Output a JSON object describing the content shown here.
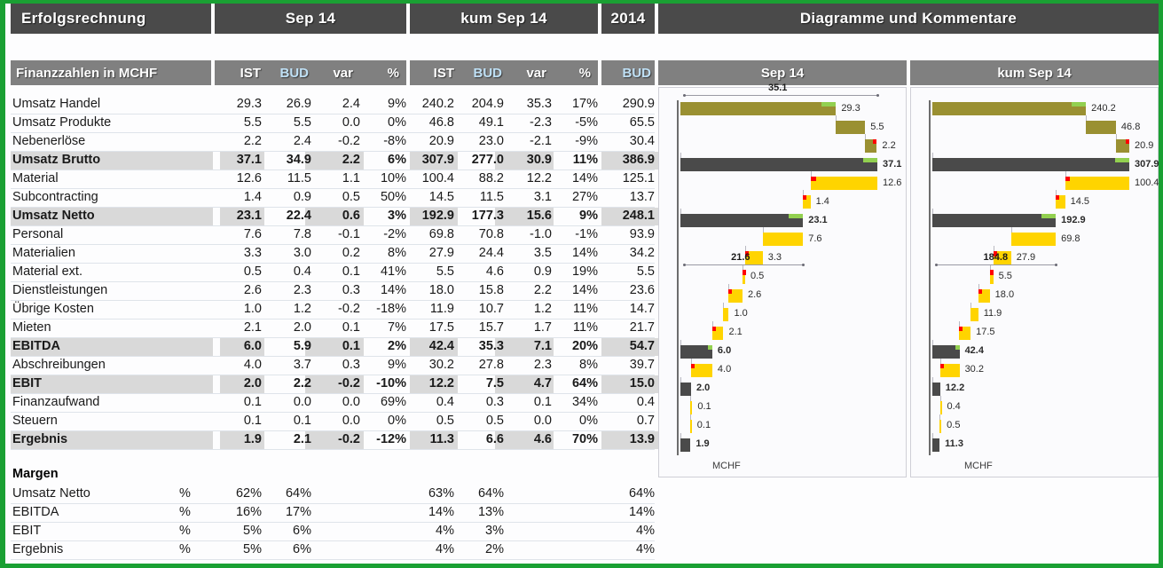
{
  "titlebar": {
    "report_title": "Erfolgsrechnung",
    "period_title": "Sep 14",
    "cumulative_title": "kum Sep 14",
    "year_title": "2014",
    "charts_title": "Diagramme und Kommentare"
  },
  "header": {
    "row_label": "Finanzzahlen in MCHF",
    "period_cols": [
      "IST",
      "BUD",
      "var",
      "%"
    ],
    "cumulative_cols": [
      "IST",
      "BUD",
      "var",
      "%"
    ],
    "year_col": "BUD",
    "chart_left_title": "Sep 14",
    "chart_right_title": "kum Sep 14"
  },
  "table": {
    "rows": [
      {
        "label": "Umsatz Handel",
        "total": false,
        "m_ist": "29.3",
        "m_bud": "26.9",
        "m_var": "2.4",
        "m_pct": "9%",
        "c_ist": "240.2",
        "c_bud": "204.9",
        "c_var": "35.3",
        "c_pct": "17%",
        "y_bud": "290.9"
      },
      {
        "label": "Umsatz Produkte",
        "total": false,
        "m_ist": "5.5",
        "m_bud": "5.5",
        "m_var": "0.0",
        "m_pct": "0%",
        "c_ist": "46.8",
        "c_bud": "49.1",
        "c_var": "-2.3",
        "c_pct": "-5%",
        "y_bud": "65.5"
      },
      {
        "label": "Nebenerlöse",
        "total": false,
        "m_ist": "2.2",
        "m_bud": "2.4",
        "m_var": "-0.2",
        "m_pct": "-8%",
        "c_ist": "20.9",
        "c_bud": "23.0",
        "c_var": "-2.1",
        "c_pct": "-9%",
        "y_bud": "30.4"
      },
      {
        "label": "Umsatz Brutto",
        "total": true,
        "m_ist": "37.1",
        "m_bud": "34.9",
        "m_var": "2.2",
        "m_pct": "6%",
        "c_ist": "307.9",
        "c_bud": "277.0",
        "c_var": "30.9",
        "c_pct": "11%",
        "y_bud": "386.9"
      },
      {
        "label": "Material",
        "total": false,
        "m_ist": "12.6",
        "m_bud": "11.5",
        "m_var": "1.1",
        "m_pct": "10%",
        "c_ist": "100.4",
        "c_bud": "88.2",
        "c_var": "12.2",
        "c_pct": "14%",
        "y_bud": "125.1"
      },
      {
        "label": "Subcontracting",
        "total": false,
        "m_ist": "1.4",
        "m_bud": "0.9",
        "m_var": "0.5",
        "m_pct": "50%",
        "c_ist": "14.5",
        "c_bud": "11.5",
        "c_var": "3.1",
        "c_pct": "27%",
        "y_bud": "13.7"
      },
      {
        "label": "Umsatz Netto",
        "total": true,
        "m_ist": "23.1",
        "m_bud": "22.4",
        "m_var": "0.6",
        "m_pct": "3%",
        "c_ist": "192.9",
        "c_bud": "177.3",
        "c_var": "15.6",
        "c_pct": "9%",
        "y_bud": "248.1"
      },
      {
        "label": "Personal",
        "total": false,
        "m_ist": "7.6",
        "m_bud": "7.8",
        "m_var": "-0.1",
        "m_pct": "-2%",
        "c_ist": "69.8",
        "c_bud": "70.8",
        "c_var": "-1.0",
        "c_pct": "-1%",
        "y_bud": "93.9"
      },
      {
        "label": "Materialien",
        "total": false,
        "m_ist": "3.3",
        "m_bud": "3.0",
        "m_var": "0.2",
        "m_pct": "8%",
        "c_ist": "27.9",
        "c_bud": "24.4",
        "c_var": "3.5",
        "c_pct": "14%",
        "y_bud": "34.2"
      },
      {
        "label": "Material ext.",
        "total": false,
        "m_ist": "0.5",
        "m_bud": "0.4",
        "m_var": "0.1",
        "m_pct": "41%",
        "c_ist": "5.5",
        "c_bud": "4.6",
        "c_var": "0.9",
        "c_pct": "19%",
        "y_bud": "5.5"
      },
      {
        "label": "Dienstleistungen",
        "total": false,
        "m_ist": "2.6",
        "m_bud": "2.3",
        "m_var": "0.3",
        "m_pct": "14%",
        "c_ist": "18.0",
        "c_bud": "15.8",
        "c_var": "2.2",
        "c_pct": "14%",
        "y_bud": "23.6"
      },
      {
        "label": "Übrige Kosten",
        "total": false,
        "m_ist": "1.0",
        "m_bud": "1.2",
        "m_var": "-0.2",
        "m_pct": "-18%",
        "c_ist": "11.9",
        "c_bud": "10.7",
        "c_var": "1.2",
        "c_pct": "11%",
        "y_bud": "14.7"
      },
      {
        "label": "Mieten",
        "total": false,
        "m_ist": "2.1",
        "m_bud": "2.0",
        "m_var": "0.1",
        "m_pct": "7%",
        "c_ist": "17.5",
        "c_bud": "15.7",
        "c_var": "1.7",
        "c_pct": "11%",
        "y_bud": "21.7"
      },
      {
        "label": "EBITDA",
        "total": true,
        "m_ist": "6.0",
        "m_bud": "5.9",
        "m_var": "0.1",
        "m_pct": "2%",
        "c_ist": "42.4",
        "c_bud": "35.3",
        "c_var": "7.1",
        "c_pct": "20%",
        "y_bud": "54.7"
      },
      {
        "label": "Abschreibungen",
        "total": false,
        "m_ist": "4.0",
        "m_bud": "3.7",
        "m_var": "0.3",
        "m_pct": "9%",
        "c_ist": "30.2",
        "c_bud": "27.8",
        "c_var": "2.3",
        "c_pct": "8%",
        "y_bud": "39.7"
      },
      {
        "label": "EBIT",
        "total": true,
        "m_ist": "2.0",
        "m_bud": "2.2",
        "m_var": "-0.2",
        "m_pct": "-10%",
        "c_ist": "12.2",
        "c_bud": "7.5",
        "c_var": "4.7",
        "c_pct": "64%",
        "y_bud": "15.0"
      },
      {
        "label": "Finanzaufwand",
        "total": false,
        "m_ist": "0.1",
        "m_bud": "0.0",
        "m_var": "0.0",
        "m_pct": "69%",
        "c_ist": "0.4",
        "c_bud": "0.3",
        "c_var": "0.1",
        "c_pct": "34%",
        "y_bud": "0.4"
      },
      {
        "label": "Steuern",
        "total": false,
        "m_ist": "0.1",
        "m_bud": "0.1",
        "m_var": "0.0",
        "m_pct": "0%",
        "c_ist": "0.5",
        "c_bud": "0.5",
        "c_var": "0.0",
        "c_pct": "0%",
        "y_bud": "0.7"
      },
      {
        "label": "Ergebnis",
        "total": true,
        "m_ist": "1.9",
        "m_bud": "2.1",
        "m_var": "-0.2",
        "m_pct": "-12%",
        "c_ist": "11.3",
        "c_bud": "6.6",
        "c_var": "4.6",
        "c_pct": "70%",
        "y_bud": "13.9"
      }
    ],
    "margins_title": "Margen",
    "margins": [
      {
        "label": "Umsatz Netto",
        "unit": "%",
        "m_ist": "62%",
        "m_bud": "64%",
        "c_ist": "63%",
        "c_bud": "64%",
        "y_bud": "64%"
      },
      {
        "label": "EBITDA",
        "unit": "%",
        "m_ist": "16%",
        "m_bud": "17%",
        "c_ist": "14%",
        "c_bud": "13%",
        "y_bud": "14%"
      },
      {
        "label": "EBIT",
        "unit": "%",
        "m_ist": "5%",
        "m_bud": "6%",
        "c_ist": "4%",
        "c_bud": "3%",
        "y_bud": "4%"
      },
      {
        "label": "Ergebnis",
        "unit": "%",
        "m_ist": "5%",
        "m_bud": "6%",
        "c_ist": "4%",
        "c_bud": "2%",
        "y_bud": "4%"
      }
    ]
  },
  "colors": {
    "accent_green": "#1aa033",
    "title_bar": "#4a4a4a",
    "header_bar": "#808080",
    "total_row": "#d9d9d9",
    "bar_total": "#4a4a4a",
    "bar_revenue": "#9a9032",
    "bar_cost": "#ffd400",
    "marker_good": "#92d050",
    "marker_bad": "#ff0000",
    "bud_header_text": "#bfe0f5"
  },
  "chart_data": [
    {
      "type": "bar",
      "title": "Sep 14",
      "subtype": "waterfall",
      "ylabel": "MCHF",
      "xlabel": "",
      "unit_label": "MCHF",
      "xlim": [
        0,
        37.1
      ],
      "categories": [
        "Umsatz Handel",
        "Umsatz Produkte",
        "Nebenerlöse",
        "Umsatz Brutto",
        "Material",
        "Subcontracting",
        "Umsatz Netto",
        "Personal",
        "Materialien",
        "Material ext.",
        "Dienstleistungen",
        "Übrige Kosten",
        "Mieten",
        "EBITDA",
        "Abschreibungen",
        "EBIT",
        "Finanzaufwand",
        "Steuern",
        "Ergebnis"
      ],
      "values": [
        29.3,
        5.5,
        2.2,
        37.1,
        12.6,
        1.4,
        23.1,
        7.6,
        3.3,
        0.5,
        2.6,
        1.0,
        2.1,
        6.0,
        4.0,
        2.0,
        0.1,
        0.1,
        1.9
      ],
      "labels": [
        "29.3",
        "5.5",
        "2.2",
        "37.1",
        "12.6",
        "1.4",
        "23.1",
        "7.6",
        "3.3",
        "0.5",
        "2.6",
        "1.0",
        "2.1",
        "6.0",
        "4.0",
        "2.0",
        "0.1",
        "0.1",
        "1.9"
      ],
      "kinds": [
        "revenue",
        "revenue",
        "revenue",
        "total",
        "cost",
        "cost",
        "total",
        "cost",
        "cost",
        "cost",
        "cost",
        "cost",
        "cost",
        "total",
        "cost",
        "total",
        "cost",
        "cost",
        "total"
      ],
      "markers": [
        "good",
        "none",
        "bad",
        "good",
        "bad",
        "bad",
        "good",
        "none",
        "bad",
        "bad",
        "bad",
        "none",
        "bad",
        "good",
        "bad",
        "none",
        "none",
        "none",
        "none"
      ],
      "brackets": [
        {
          "label": "35.1",
          "from": "Umsatz Handel",
          "to": "Umsatz Brutto",
          "value": 35.1,
          "position": "top"
        },
        {
          "label": "21.6",
          "from": "Umsatz Netto",
          "to": "Materialien",
          "value": 21.6,
          "position": "mid"
        }
      ]
    },
    {
      "type": "bar",
      "title": "kum Sep 14",
      "subtype": "waterfall",
      "ylabel": "MCHF",
      "xlabel": "",
      "unit_label": "MCHF",
      "xlim": [
        0,
        307.9
      ],
      "categories": [
        "Umsatz Handel",
        "Umsatz Produkte",
        "Nebenerlöse",
        "Umsatz Brutto",
        "Material",
        "Subcontracting",
        "Umsatz Netto",
        "Personal",
        "Materialien",
        "Material ext.",
        "Dienstleistungen",
        "Übrige Kosten",
        "Mieten",
        "EBITDA",
        "Abschreibungen",
        "EBIT",
        "Finanzaufwand",
        "Steuern",
        "Ergebnis"
      ],
      "values": [
        240.2,
        46.8,
        20.9,
        307.9,
        100.4,
        14.5,
        192.9,
        69.8,
        27.9,
        5.5,
        18.0,
        11.9,
        17.5,
        42.4,
        30.2,
        12.2,
        0.4,
        0.5,
        11.3
      ],
      "labels": [
        "240.2",
        "46.8",
        "20.9",
        "307.9",
        "100.4",
        "14.5",
        "192.9",
        "69.8",
        "27.9",
        "5.5",
        "18.0",
        "11.9",
        "17.5",
        "42.4",
        "30.2",
        "12.2",
        "0.4",
        "0.5",
        "11.3"
      ],
      "kinds": [
        "revenue",
        "revenue",
        "revenue",
        "total",
        "cost",
        "cost",
        "total",
        "cost",
        "cost",
        "cost",
        "cost",
        "cost",
        "cost",
        "total",
        "cost",
        "total",
        "cost",
        "cost",
        "total"
      ],
      "markers": [
        "good",
        "none",
        "bad",
        "good",
        "bad",
        "bad",
        "good",
        "none",
        "bad",
        "bad",
        "bad",
        "none",
        "bad",
        "good",
        "bad",
        "none",
        "none",
        "none",
        "none"
      ],
      "brackets": [
        {
          "label": "184.8",
          "from": "Umsatz Netto",
          "to": "Materialien",
          "value": 184.8,
          "position": "mid"
        }
      ]
    }
  ]
}
